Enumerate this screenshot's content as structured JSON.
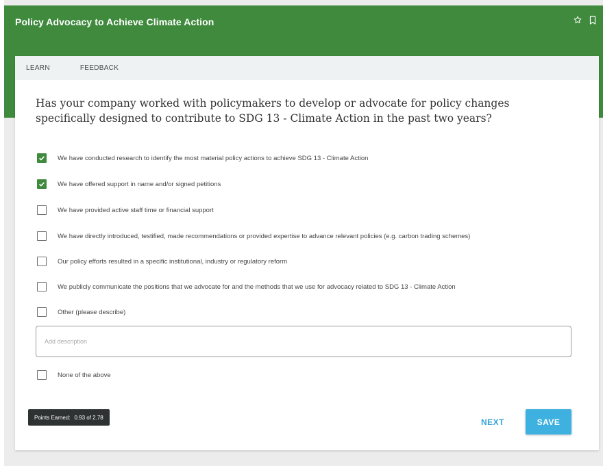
{
  "header": {
    "title": "Policy Advocacy to Achieve Climate Action"
  },
  "tabs": [
    {
      "label": "LEARN"
    },
    {
      "label": "FEEDBACK"
    }
  ],
  "question": {
    "text": "Has your company worked with policymakers to develop or advocate for policy changes specifically designed to contribute to SDG 13 - Climate Action in the past two years?"
  },
  "options": [
    {
      "label": "We have conducted research to identify the most material policy actions to achieve SDG 13 - Climate Action",
      "checked": true
    },
    {
      "label": "We have offered support in name and/or signed petitions",
      "checked": true
    },
    {
      "label": "We have provided active staff time or financial support",
      "checked": false
    },
    {
      "label": "We have directly introduced, testified, made recommendations or provided expertise to advance relevant policies (e.g. carbon trading schemes)",
      "checked": false
    },
    {
      "label": "Our policy efforts resulted in a specific institutional, industry or regulatory reform",
      "checked": false
    },
    {
      "label": "We publicly communicate the positions that we advocate for and the methods that we use for advocacy related to SDG 13 - Climate Action",
      "checked": false
    },
    {
      "label": "Other (please describe)",
      "checked": false
    },
    {
      "label": "None of the above",
      "checked": false
    }
  ],
  "description": {
    "placeholder": "Add description",
    "value": ""
  },
  "points": {
    "label": "Points Earned:",
    "value": "0.93 of 2.78"
  },
  "actions": {
    "next_label": "NEXT",
    "save_label": "SAVE"
  },
  "colors": {
    "brand_green": "#3f8a3d",
    "accent_blue": "#3eb1e0"
  },
  "icons": {
    "star": "star-outline-icon",
    "bookmark": "bookmark-outline-icon",
    "check": "check-icon"
  }
}
